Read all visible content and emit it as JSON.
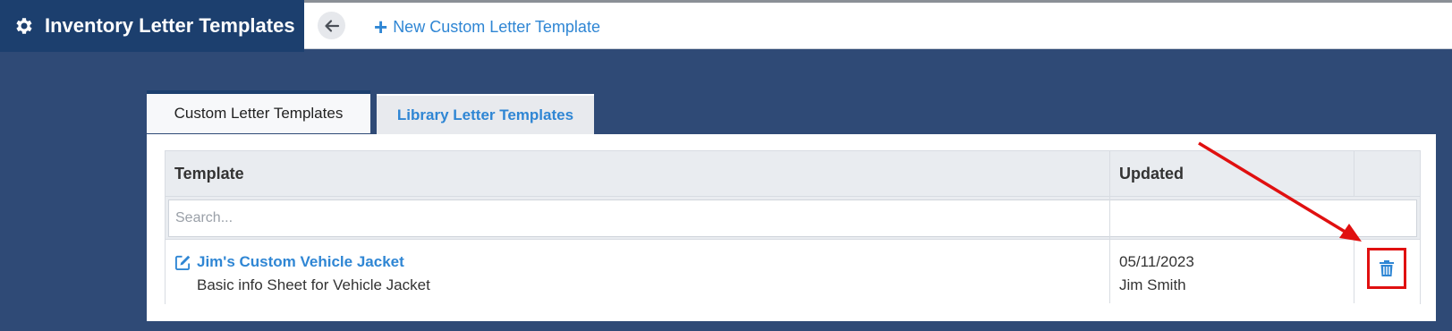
{
  "header": {
    "title": "Inventory Letter Templates",
    "new_template_label": "New Custom Letter Template",
    "icons": {
      "title": "gear-icon",
      "back": "arrow-left-icon",
      "new": "plus-icon"
    }
  },
  "tabs": [
    {
      "label": "Custom Letter Templates",
      "active": true
    },
    {
      "label": "Library Letter Templates",
      "active": false
    }
  ],
  "table": {
    "columns": [
      "Template",
      "Updated",
      ""
    ],
    "search": {
      "placeholder": "Search...",
      "value": ""
    },
    "rows": [
      {
        "name": "Jim's Custom Vehicle Jacket",
        "description": "Basic info Sheet for Vehicle Jacket",
        "updated_date": "05/11/2023",
        "updated_by": "Jim Smith",
        "edit_icon": "edit-icon",
        "delete_icon": "trash-icon"
      }
    ]
  },
  "colors": {
    "background": "#2f4a76",
    "title_bar": "#1c3f6e",
    "link": "#2f86d4",
    "annotation": "#e01010"
  }
}
